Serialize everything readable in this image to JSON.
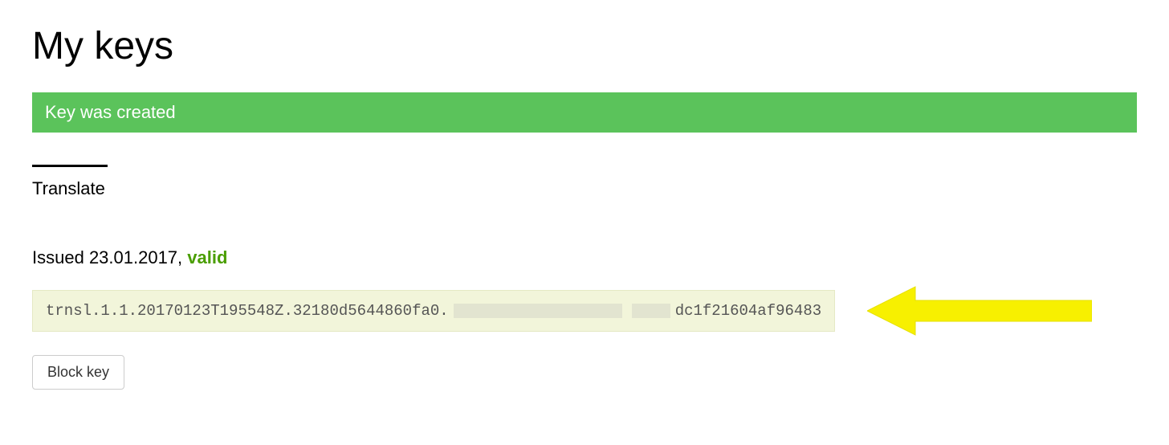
{
  "page": {
    "title": "My keys"
  },
  "alert": {
    "message": "Key was created"
  },
  "tabs": {
    "translate": "Translate"
  },
  "key": {
    "issued_prefix": "Issued ",
    "issued_date": "23.01.2017",
    "separator": ", ",
    "status": "valid",
    "value_part1": "trnsl.1.1.20170123T195548Z.32180d5644860fa0.",
    "value_part2": "dc1f21604af96483"
  },
  "buttons": {
    "block_key": "Block key"
  }
}
